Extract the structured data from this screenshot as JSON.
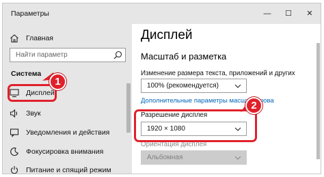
{
  "window": {
    "title": "Параметры",
    "controls": {
      "minimize": "—",
      "maximize": "☐",
      "close": "✕"
    }
  },
  "sidebar": {
    "home": "Главная",
    "search_placeholder": "Найти параметр",
    "section": "Система",
    "items": [
      {
        "label": "Дисплей",
        "icon": "monitor-icon",
        "active": true
      },
      {
        "label": "Звук",
        "icon": "speaker-icon"
      },
      {
        "label": "Уведомления и действия",
        "icon": "notification-icon"
      },
      {
        "label": "Фокусировка внимания",
        "icon": "moon-icon"
      },
      {
        "label": "Питание и спящий режим",
        "icon": "power-icon"
      }
    ]
  },
  "main": {
    "title": "Дисплей",
    "section": "Масштаб и разметка",
    "scale_label": "Изменение размера текста, приложений и других элементов",
    "scale_value": "100% (рекомендуется)",
    "advanced_link": "Дополнительные параметры масштабирова",
    "resolution_label": "Разрешение дисплея",
    "resolution_value": "1920 × 1080",
    "orientation_label": "Ориентация дисплея",
    "orientation_value": "Альбомная"
  },
  "callouts": {
    "first": "1",
    "second": "2"
  },
  "colors": {
    "accent_red": "#e0202a",
    "link_blue": "#0066b8",
    "sidebar_bg": "#e6e6e6"
  }
}
